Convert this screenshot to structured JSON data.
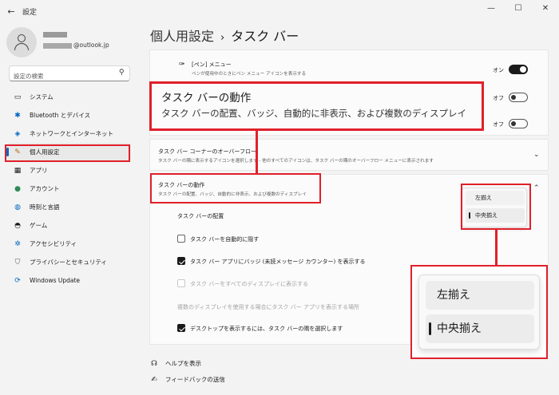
{
  "window": {
    "back_icon": "back-arrow-icon",
    "title": "設定",
    "min": "—",
    "max": "☐",
    "close": "✕"
  },
  "profile": {
    "email_domain": "@outlook.jp"
  },
  "search": {
    "placeholder": "設定の検索"
  },
  "nav": {
    "items": [
      {
        "label": "システム",
        "icon": "monitor-icon"
      },
      {
        "label": "Bluetooth とデバイス",
        "icon": "bluetooth-icon"
      },
      {
        "label": "ネットワークとインターネット",
        "icon": "wifi-icon"
      },
      {
        "label": "個人用設定",
        "icon": "brush-icon"
      },
      {
        "label": "アプリ",
        "icon": "apps-icon"
      },
      {
        "label": "アカウント",
        "icon": "account-icon"
      },
      {
        "label": "時刻と言語",
        "icon": "globe-clock-icon"
      },
      {
        "label": "ゲーム",
        "icon": "game-icon"
      },
      {
        "label": "アクセシビリティ",
        "icon": "accessibility-icon"
      },
      {
        "label": "プライバシーとセキュリティ",
        "icon": "shield-icon"
      },
      {
        "label": "Windows Update",
        "icon": "update-icon"
      }
    ]
  },
  "breadcrumb": {
    "parent": "個人用設定",
    "separator": "›",
    "current": "タスク バー"
  },
  "pen_menu": {
    "title": "[ペン] メニュー",
    "subtitle": "ペンが使用中のときにペン メニュー アイコンを表示する",
    "state": "オン"
  },
  "toggles": {
    "row2_state": "オフ",
    "row3_state": "オフ"
  },
  "callout": {
    "title": "タスク バーの動作",
    "subtitle": "タスク バーの配置、バッジ、自動的に非表示、および複数のディスプレイ"
  },
  "overflow": {
    "title": "タスク バー コーナーのオーバーフロー",
    "subtitle": "タスク バーの隅に表示するアイコンを選択します - 他のすべてのアイコンは、タスク バーの隅のオーバーフロー メニューに表示されます"
  },
  "behavior": {
    "title": "タスク バーの動作",
    "subtitle": "タスク バーの配置、バッジ、自動的に非表示、および複数のディスプレイ",
    "alignment_label": "タスク バーの配置",
    "options": [
      {
        "label": "タスク バーを自動的に隠す",
        "checked": false,
        "disabled": false
      },
      {
        "label": "タスク バー アプリにバッジ (未読メッセージ カウンター) を表示する",
        "checked": true,
        "disabled": false
      },
      {
        "label": "タスク バーをすべてのディスプレイに表示する",
        "checked": false,
        "disabled": true
      }
    ],
    "multi_display_label": "複数のディスプレイを使用する場合にタスク バー アプリを表示する場所",
    "desktop_option": "デスクトップを表示するには、タスク バーの隅を選択します"
  },
  "alignment_menu": {
    "left": "左揃え",
    "center": "中央揃え",
    "selected": "中央揃え"
  },
  "footer": {
    "help": "ヘルプを表示",
    "feedback": "フィードバックの送信"
  },
  "colors": {
    "highlight": "#e0202a",
    "accent": "#0067c0"
  }
}
